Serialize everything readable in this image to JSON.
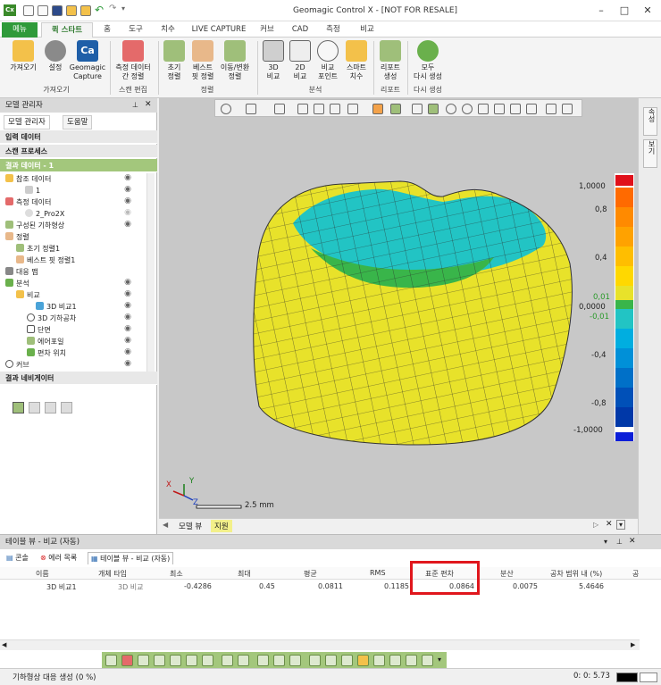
{
  "window": {
    "title": "Geomagic Control X - [NOT FOR RESALE]",
    "app_icon": "Cx"
  },
  "tabs": [
    "메뉴",
    "퀵 스타트",
    "홈",
    "도구",
    "치수",
    "LIVE CAPTURE",
    "커브",
    "CAD",
    "측정",
    "비교"
  ],
  "ribbon": {
    "buttons": [
      {
        "label": "가져오기",
        "icon": "import-icon"
      },
      {
        "label": "설정",
        "icon": "gear-icon"
      },
      {
        "label": "Geomagic Capture",
        "label1": "Geomagic",
        "label2": "Capture",
        "icon": "capture-icon"
      },
      {
        "label1": "측정 데이터",
        "label2": "간 정렬",
        "icon": "align-icon"
      },
      {
        "label1": "초기",
        "label2": "정렬",
        "icon": "initial-align-icon"
      },
      {
        "label1": "베스트",
        "label2": "핏 정렬",
        "icon": "best-fit-icon"
      },
      {
        "label1": "이동/변환",
        "label2": "정렬",
        "icon": "move-icon"
      },
      {
        "label1": "3D",
        "label2": "비교",
        "icon": "3d-compare-icon"
      },
      {
        "label1": "2D",
        "label2": "비교",
        "icon": "2d-compare-icon"
      },
      {
        "label1": "비교",
        "label2": "포인트",
        "icon": "compare-point-icon"
      },
      {
        "label1": "스마트",
        "label2": "치수",
        "icon": "smart-dim-icon"
      },
      {
        "label1": "리포트",
        "label2": "생성",
        "icon": "report-icon"
      },
      {
        "label1": "모두",
        "label2": "다시 생성",
        "icon": "regen-icon"
      }
    ],
    "groups": [
      "가져오기",
      "스캔 편집",
      "정렬",
      "분석",
      "리포트",
      "다시 생성"
    ]
  },
  "left_panel": {
    "title": "모델 관리자",
    "tabs": [
      "모델 관리자",
      "도움말"
    ],
    "sections": [
      "입력 데이터",
      "스캔 프로세스",
      "결과 데이터 - 1",
      "결과 네비게이터"
    ],
    "tree": [
      {
        "label": "참조 데이터",
        "level": 0
      },
      {
        "label": "1",
        "level": 1
      },
      {
        "label": "측정 데이터",
        "level": 0
      },
      {
        "label": "2_Pro2X",
        "level": 1
      },
      {
        "label": "구성된 기하형상",
        "level": 0
      },
      {
        "label": "정렬",
        "level": 0
      },
      {
        "label": "초기 정렬1",
        "level": 1
      },
      {
        "label": "베스트 핏 정렬1",
        "level": 1
      },
      {
        "label": "대응 맵",
        "level": 0
      },
      {
        "label": "분석",
        "level": 0
      },
      {
        "label": "비교",
        "level": 1
      },
      {
        "label": "3D 비교1",
        "level": 2
      },
      {
        "label": "3D 기하공차",
        "level": 1
      },
      {
        "label": "단면",
        "level": 1
      },
      {
        "label": "에어포일",
        "level": 1
      },
      {
        "label": "편차 위치",
        "level": 1
      },
      {
        "label": "커브",
        "level": 0
      }
    ]
  },
  "viewport": {
    "scale_label": "2.5 mm",
    "axes": {
      "x": "X",
      "y": "Y",
      "z": "Z"
    },
    "colorbar": [
      "1,0000",
      "0,8",
      "0,4",
      "0,01",
      "0,0000",
      "-0,01",
      "-0,4",
      "-0,8",
      "-1,0000"
    ],
    "tabs": [
      "모델 뷰",
      "지원"
    ]
  },
  "right_strip": [
    "속성",
    "보기"
  ],
  "bottom_panel": {
    "title": "테이블 뷰 - 비교 (자동)",
    "tabs": [
      "콘솔",
      "에러 목록",
      "테이블 뷰 - 비교 (자동)"
    ],
    "headers": [
      "이름",
      "개체 타입",
      "최소",
      "최대",
      "평균",
      "RMS",
      "표준 편차",
      "분산",
      "공차 범위 내 (%)",
      "공"
    ],
    "row": [
      "3D 비교1",
      "3D 비교",
      "-0.4286",
      "0.45",
      "0.0811",
      "0.1185",
      "0.0864",
      "0.0075",
      "5.4646"
    ]
  },
  "status": {
    "text": "기하형상 대응 생성 (0 %)",
    "time": "0: 0: 5.73"
  },
  "colors": {
    "accent": "#2f9a3a",
    "highlight": "#e0161c"
  }
}
